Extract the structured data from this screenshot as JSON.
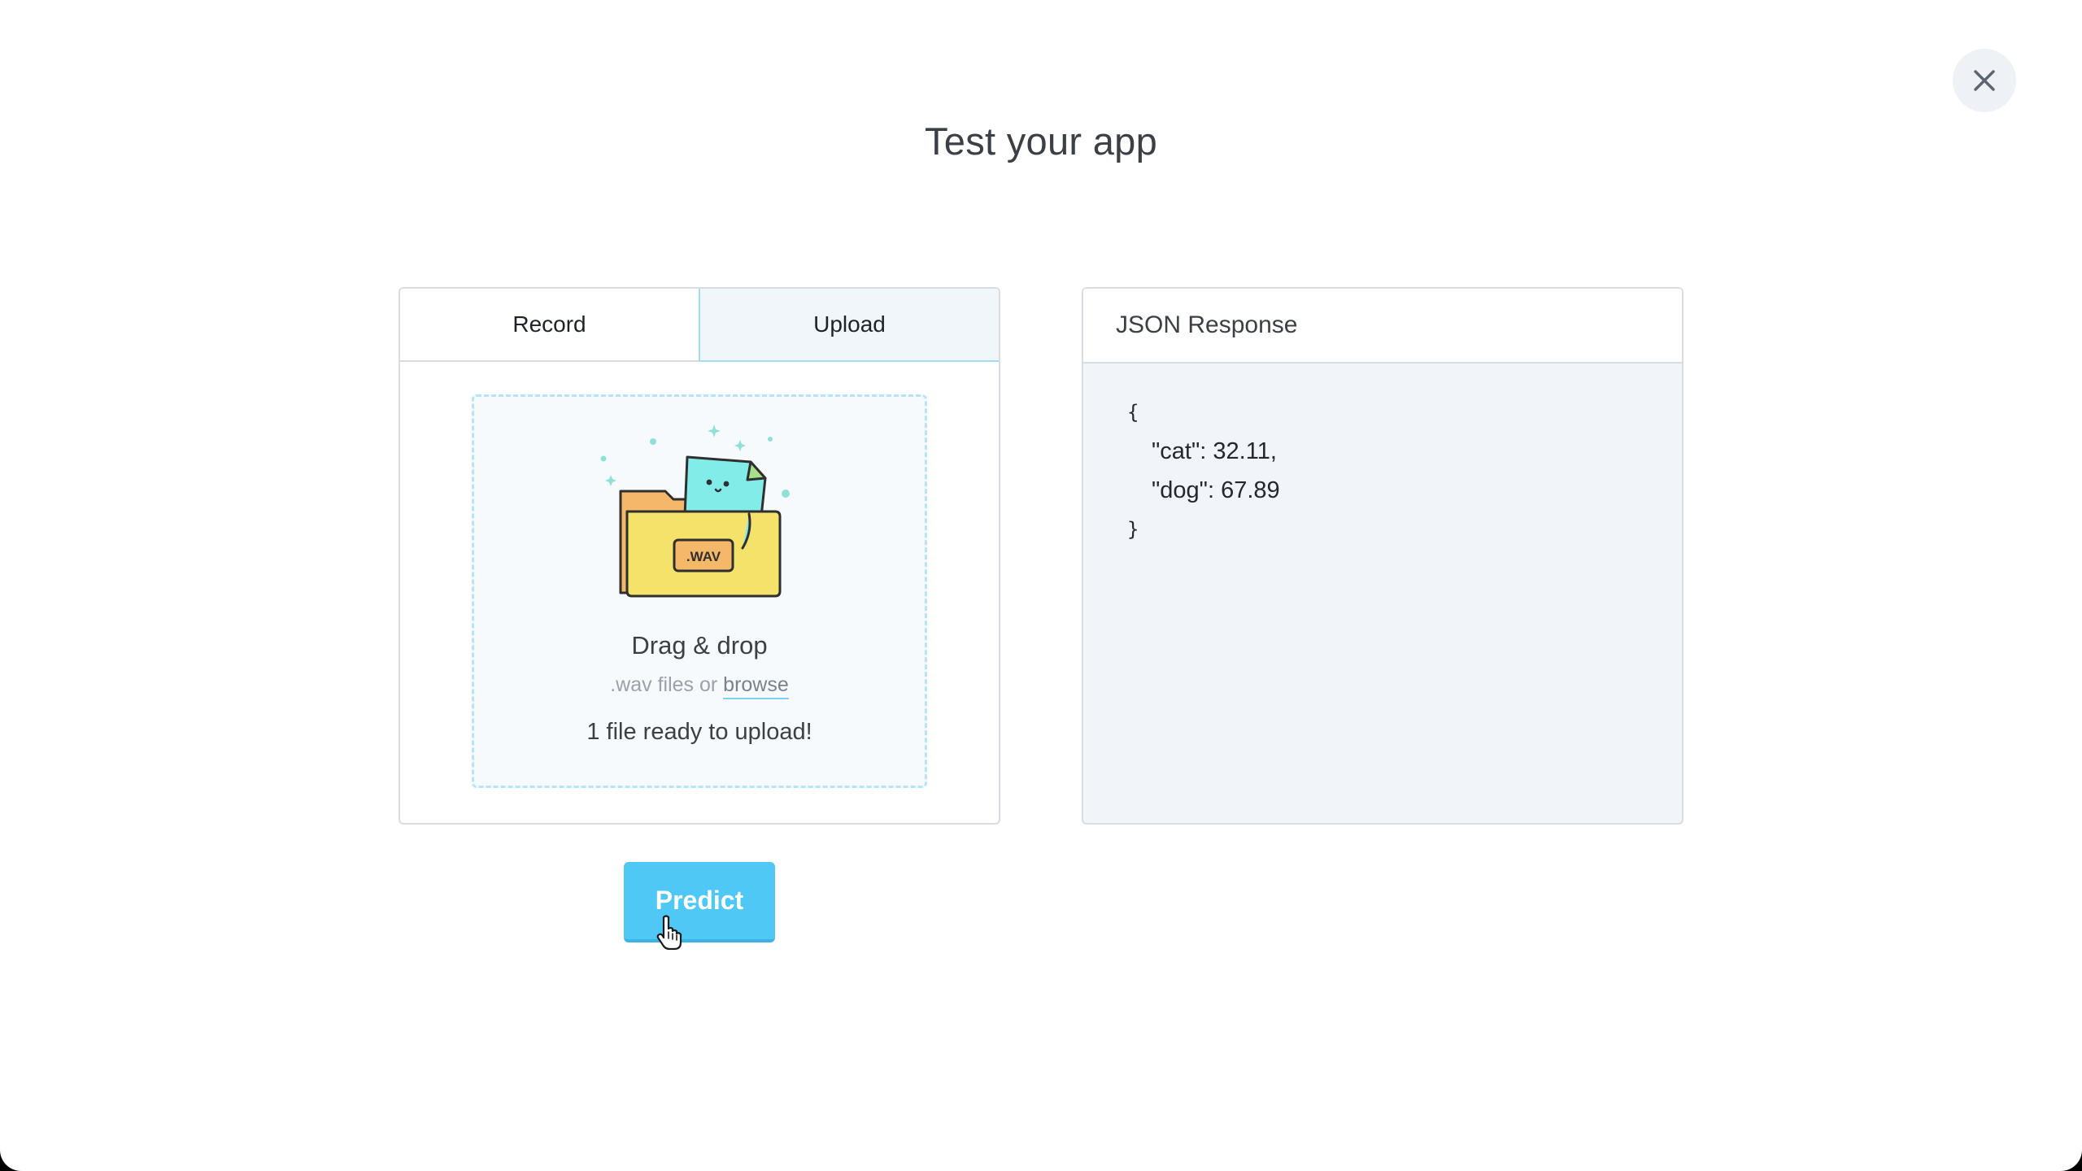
{
  "modal": {
    "title": "Test your app",
    "close_icon": "close-icon"
  },
  "tabs": [
    {
      "label": "Record",
      "active": false
    },
    {
      "label": "Upload",
      "active": true
    }
  ],
  "upload": {
    "illustration_icon": "folder-with-wav-file-illustration",
    "badge_text": ".WAV",
    "title": "Drag & drop",
    "sub_prefix": ".wav files or",
    "browse_label": "browse",
    "status": "1 file ready to upload!"
  },
  "json_panel": {
    "header": "JSON Response",
    "open_brace": "{",
    "lines": [
      {
        "key": "\"cat\"",
        "sep": ":",
        "value": "32.11,"
      },
      {
        "key": "\"dog\"",
        "sep": ":",
        "value": "67.89"
      }
    ],
    "close_brace": "}"
  },
  "predict": {
    "label": "Predict"
  },
  "colors": {
    "accent": "#4fc8f5",
    "tab_active_bg": "#f1f6fb",
    "dropzone_border": "#b4e6f8",
    "json_bg": "#f1f4f8"
  }
}
